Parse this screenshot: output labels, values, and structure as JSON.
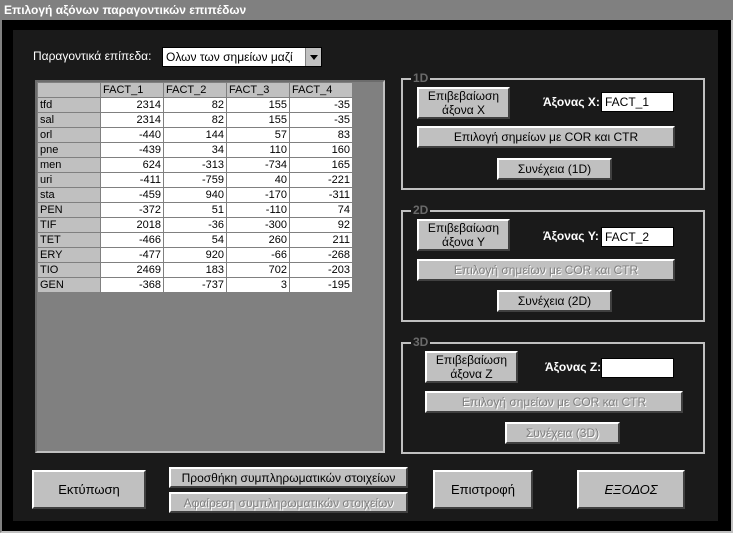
{
  "window": {
    "title": "Επιλογή αξόνων παραγοντικών επιπέδων"
  },
  "factor_levels": {
    "label": "Παραγοντικά επίπεδα:",
    "selected": "Ολων των σημείων μαζί"
  },
  "table": {
    "columns": [
      "FACT_1",
      "FACT_2",
      "FACT_3",
      "FACT_4"
    ],
    "rows": [
      {
        "label": "tfd",
        "values": [
          "2314",
          "82",
          "155",
          "-35"
        ]
      },
      {
        "label": "sal",
        "values": [
          "2314",
          "82",
          "155",
          "-35"
        ]
      },
      {
        "label": "orl",
        "values": [
          "-440",
          "144",
          "57",
          "83"
        ]
      },
      {
        "label": "pne",
        "values": [
          "-439",
          "34",
          "110",
          "160"
        ]
      },
      {
        "label": "men",
        "values": [
          "624",
          "-313",
          "-734",
          "165"
        ]
      },
      {
        "label": "uri",
        "values": [
          "-411",
          "-759",
          "40",
          "-221"
        ]
      },
      {
        "label": "sta",
        "values": [
          "-459",
          "940",
          "-170",
          "-311"
        ]
      },
      {
        "label": "PEN",
        "values": [
          "-372",
          "51",
          "-110",
          "74"
        ]
      },
      {
        "label": "TIF",
        "values": [
          "2018",
          "-36",
          "-300",
          "92"
        ]
      },
      {
        "label": "TET",
        "values": [
          "-466",
          "54",
          "260",
          "211"
        ]
      },
      {
        "label": "ERY",
        "values": [
          "-477",
          "920",
          "-66",
          "-268"
        ]
      },
      {
        "label": "TIO",
        "values": [
          "2469",
          "183",
          "702",
          "-203"
        ]
      },
      {
        "label": "GEN",
        "values": [
          "-368",
          "-737",
          "3",
          "-195"
        ]
      }
    ]
  },
  "group_1d": {
    "title": "1D",
    "confirm_line1": "Επιβεβαίωση",
    "confirm_line2": "άξονα X",
    "axis_label": "Άξονας X:",
    "axis_value": "FACT_1",
    "select_points": "Επιλογή σημείων με COR και CTR",
    "continue": "Συνέχεια (1D)"
  },
  "group_2d": {
    "title": "2D",
    "confirm_line1": "Επιβεβαίωση",
    "confirm_line2": "άξονα Y",
    "axis_label": "Άξονας Y:",
    "axis_value": "FACT_2",
    "select_points": "Επιλογή σημείων με COR και CTR",
    "continue": "Συνέχεια (2D)"
  },
  "group_3d": {
    "title": "3D",
    "confirm_line1": "Επιβεβαίωση",
    "confirm_line2": "άξονα Z",
    "axis_label": "Άξονας Z:",
    "axis_value": "",
    "select_points": "Επιλογή σημείων με COR και CTR",
    "continue": "Συνέχεια (3D)"
  },
  "bottom": {
    "print": "Εκτύπωση",
    "add_extra": "Προσθήκη συμπληρωματικών στοιχείων",
    "remove_extra": "Αφαίρεση συμπληρωματικών στοιχείων",
    "back": "Επιστροφή",
    "exit": "ΕΞΟΔΟΣ"
  }
}
